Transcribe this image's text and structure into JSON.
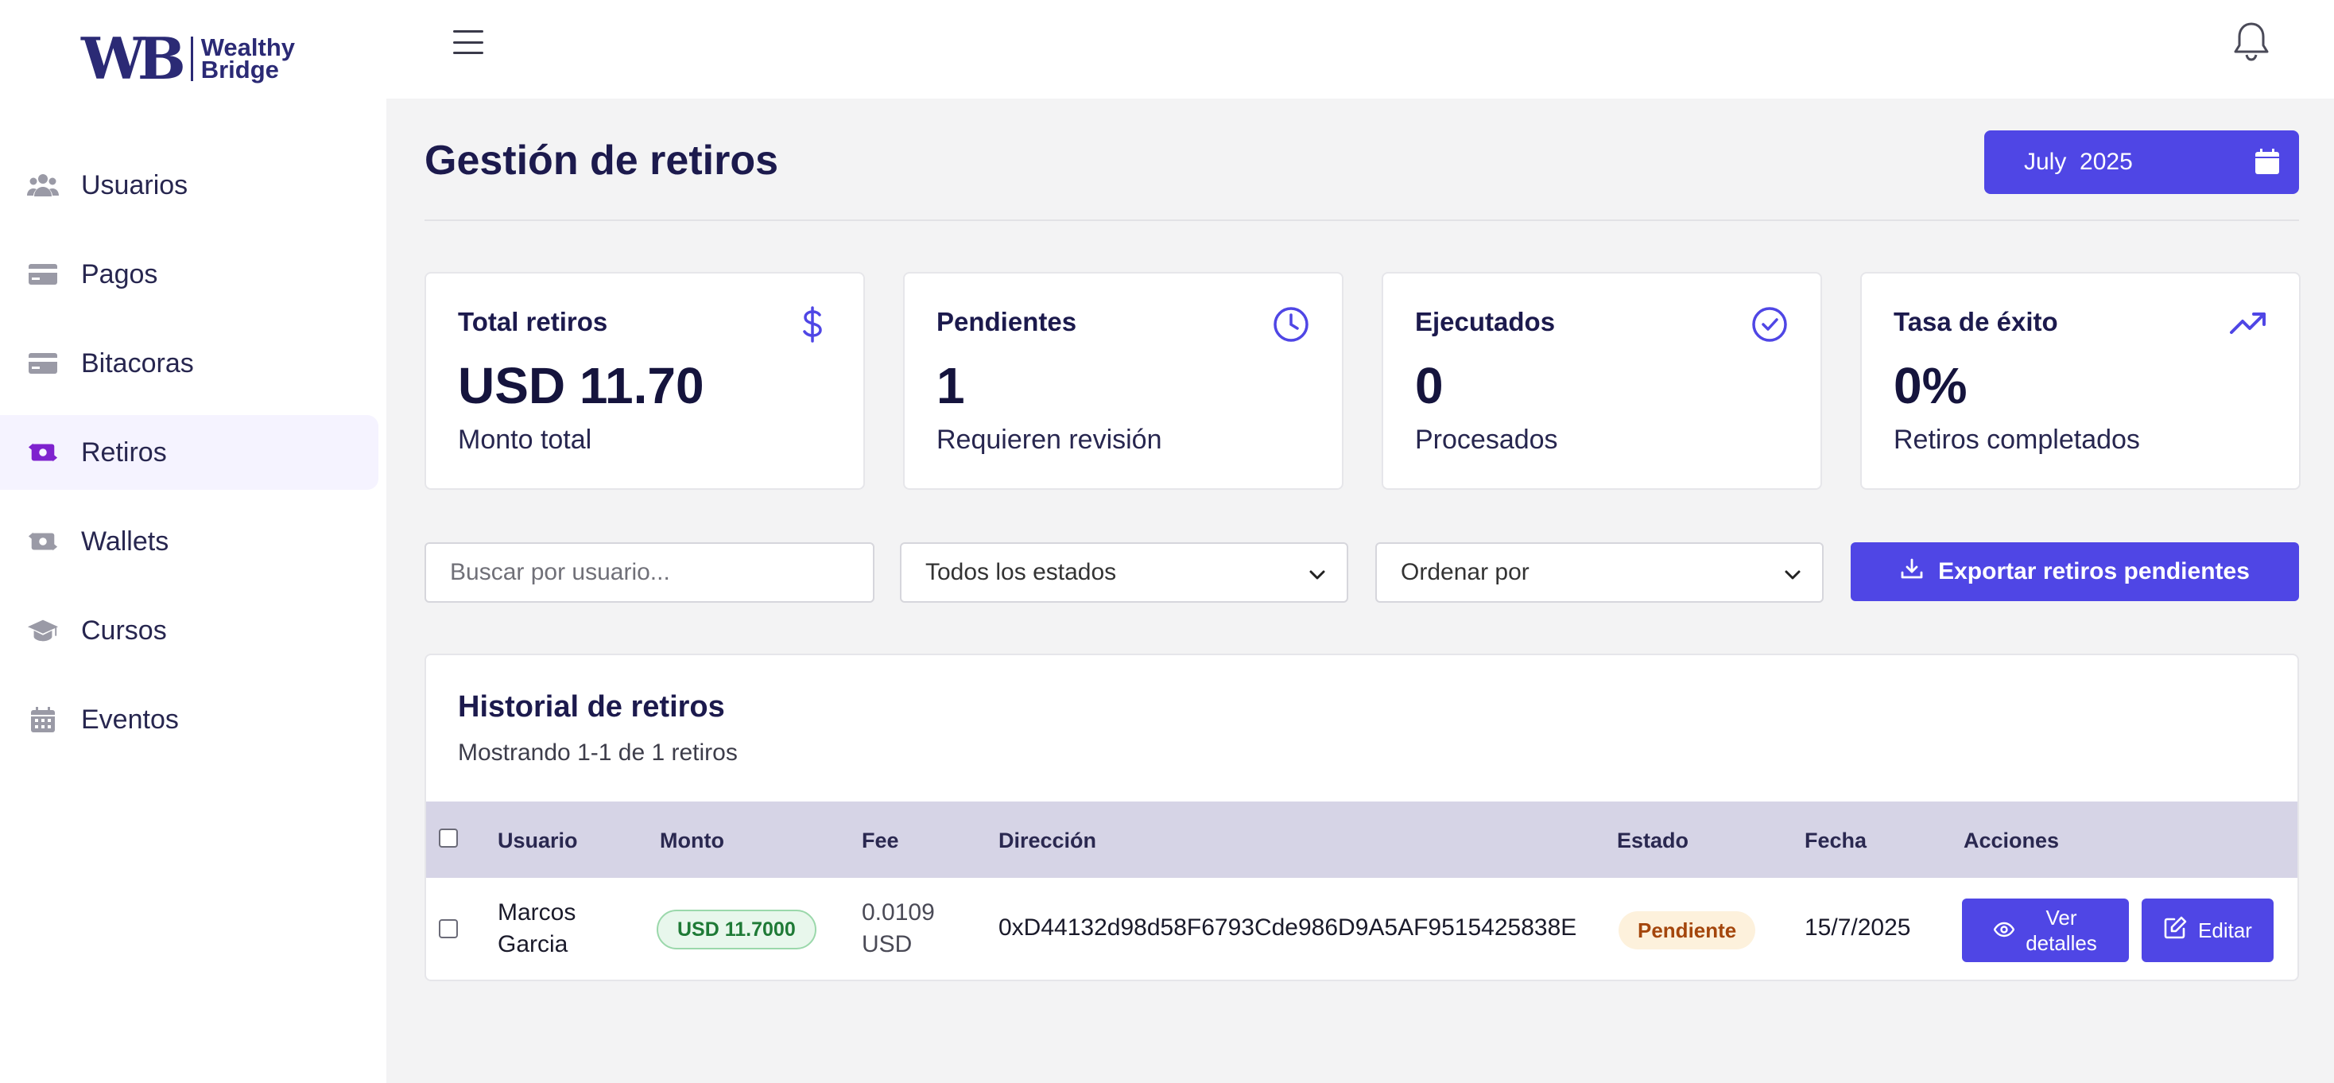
{
  "brand": {
    "mark": "WB",
    "line1": "Wealthy",
    "line2": "Bridge",
    "color": "#2b2a75"
  },
  "sidebar": {
    "items": [
      {
        "label": "Usuarios",
        "icon": "users-icon"
      },
      {
        "label": "Pagos",
        "icon": "credit-card-icon"
      },
      {
        "label": "Bitacoras",
        "icon": "credit-card-icon"
      },
      {
        "label": "Retiros",
        "icon": "money-transfer-icon",
        "active": true
      },
      {
        "label": "Wallets",
        "icon": "money-transfer-icon"
      },
      {
        "label": "Cursos",
        "icon": "graduation-cap-icon"
      },
      {
        "label": "Eventos",
        "icon": "calendar-icon"
      }
    ]
  },
  "header": {
    "menu_icon": "hamburger-icon",
    "notification_icon": "bell-icon"
  },
  "page": {
    "title": "Gestión de retiros",
    "date_month": "July",
    "date_year": "2025"
  },
  "stats": [
    {
      "title": "Total retiros",
      "value": "USD 11.70",
      "subtitle": "Monto total",
      "icon": "dollar-icon"
    },
    {
      "title": "Pendientes",
      "value": "1",
      "subtitle": "Requieren revisión",
      "icon": "clock-icon"
    },
    {
      "title": "Ejecutados",
      "value": "0",
      "subtitle": "Procesados",
      "icon": "check-circle-icon"
    },
    {
      "title": "Tasa de éxito",
      "value": "0%",
      "subtitle": "Retiros completados",
      "icon": "trending-up-icon"
    }
  ],
  "filters": {
    "search_placeholder": "Buscar por usuario...",
    "status_selected": "Todos los estados",
    "sort_selected": "Ordenar por",
    "export_label": "Exportar retiros pendientes"
  },
  "table": {
    "title": "Historial de retiros",
    "subtitle": "Mostrando 1-1 de 1 retiros",
    "columns": [
      "Usuario",
      "Monto",
      "Fee",
      "Dirección",
      "Estado",
      "Fecha",
      "Acciones"
    ],
    "rows": [
      {
        "user_first": "Marcos",
        "user_last": "Garcia",
        "amount": "USD 11.7000",
        "fee_value": "0.0109",
        "fee_currency": "USD",
        "address": "0xD44132d98d58F6793Cde986D9A5AF9515425838E",
        "status": "Pendiente",
        "date": "15/7/2025",
        "view_line1": "Ver",
        "view_line2": "detalles",
        "edit_label": "Editar"
      }
    ]
  },
  "colors": {
    "accent": "#4f46e5",
    "active_icon": "#7e22ce",
    "table_header": "#d6d4e6",
    "status_pending_bg": "#fdf1dc",
    "status_pending_text": "#a4460c",
    "amount_badge_bg": "#e8f7ec",
    "amount_badge_text": "#1f7a36"
  }
}
